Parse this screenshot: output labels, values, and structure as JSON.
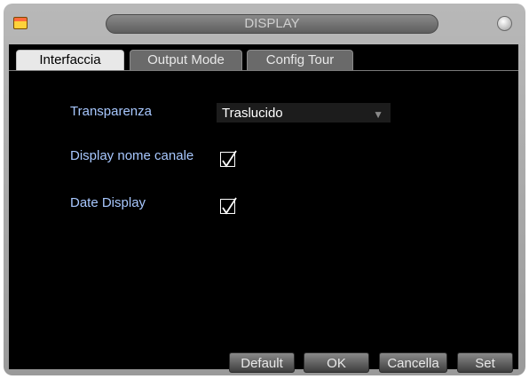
{
  "window": {
    "title": "DISPLAY"
  },
  "tabs": [
    {
      "label": "Interfaccia",
      "active": true
    },
    {
      "label": "Output Mode",
      "active": false
    },
    {
      "label": "Config Tour",
      "active": false
    }
  ],
  "settings": {
    "transparency": {
      "label": "Transparenza",
      "value": "Traslucido"
    },
    "channel_name": {
      "label": "Display nome canale",
      "checked": true
    },
    "date_display": {
      "label": "Date Display",
      "checked": true
    }
  },
  "buttons": {
    "default": "Default",
    "ok": "OK",
    "cancel": "Cancella",
    "set": "Set"
  },
  "colors": {
    "label_text": "#a8c8ff",
    "panel_background": "#000000",
    "window_frame": "#a8a8a8",
    "active_tab": "#e8e8e8"
  },
  "icons": {
    "app": "app-icon",
    "close": "close-icon",
    "dropdown": "chevron-down-icon",
    "check": "checkmark-icon"
  }
}
